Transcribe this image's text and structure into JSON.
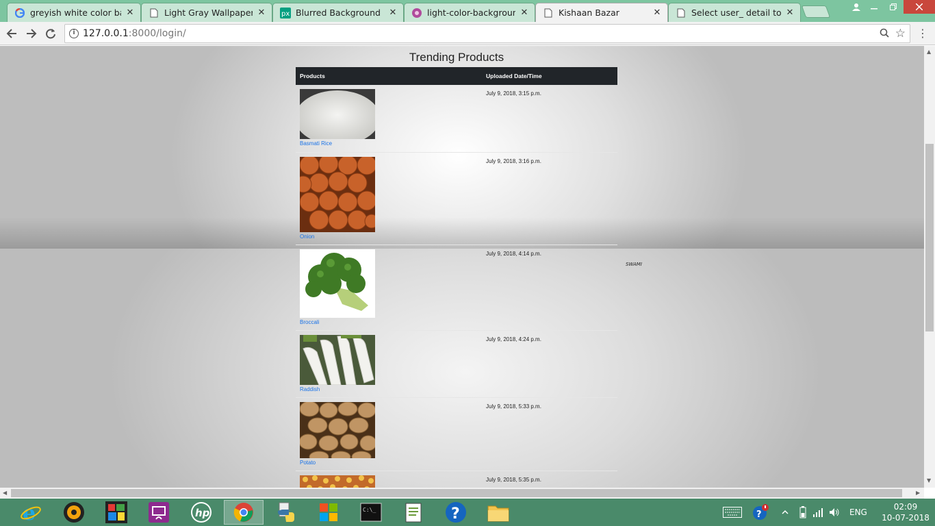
{
  "browser": {
    "tabs": [
      {
        "title": "greyish white color backg",
        "icon": "google-icon",
        "active": false
      },
      {
        "title": "Light Gray Wallpaper Ne",
        "icon": "page-icon",
        "active": false
      },
      {
        "title": "Blurred Background Imag",
        "icon": "pexels-icon",
        "active": false
      },
      {
        "title": "light-color-background-",
        "icon": "flower-icon",
        "active": false
      },
      {
        "title": "Kishaan Bazar",
        "icon": "page-icon",
        "active": true
      },
      {
        "title": "Select user_ detail to cha",
        "icon": "page-icon",
        "active": false
      }
    ],
    "close_glyph": "✕",
    "address": {
      "host": "127.0.0.1",
      "rest": ":8000/login/"
    }
  },
  "page": {
    "heading": "Trending Products",
    "columns": [
      "Products",
      "Uploaded Date/Time"
    ],
    "products": [
      {
        "name": "Basmati Rice",
        "date": "July 9, 2018, 3:15 p.m.",
        "image": "rice-image"
      },
      {
        "name": "Onion",
        "date": "July 9, 2018, 3:16 p.m.",
        "image": "onion-image"
      },
      {
        "name": "Broccali",
        "date": "July 9, 2018, 4:14 p.m.",
        "image": "broccoli-image"
      },
      {
        "name": "Raddish",
        "date": "July 9, 2018, 4:24 p.m.",
        "image": "radish-image"
      },
      {
        "name": "Potato",
        "date": "July 9, 2018, 5:33 p.m.",
        "image": "potato-image"
      },
      {
        "name": "",
        "date": "July 9, 2018, 5:35 p.m.",
        "image": "corn-image"
      }
    ],
    "stray_text": "SWAMI"
  },
  "taskbar": {
    "apps": [
      "ie-icon",
      "media-player-icon",
      "photos-icon",
      "connect-icon",
      "hp-icon",
      "chrome-icon",
      "python-icon",
      "windows-store-icon",
      "cmd-icon",
      "notepad-icon",
      "help-icon",
      "file-explorer-icon"
    ],
    "language": "ENG",
    "time": "02:09",
    "date": "10-07-2018"
  }
}
